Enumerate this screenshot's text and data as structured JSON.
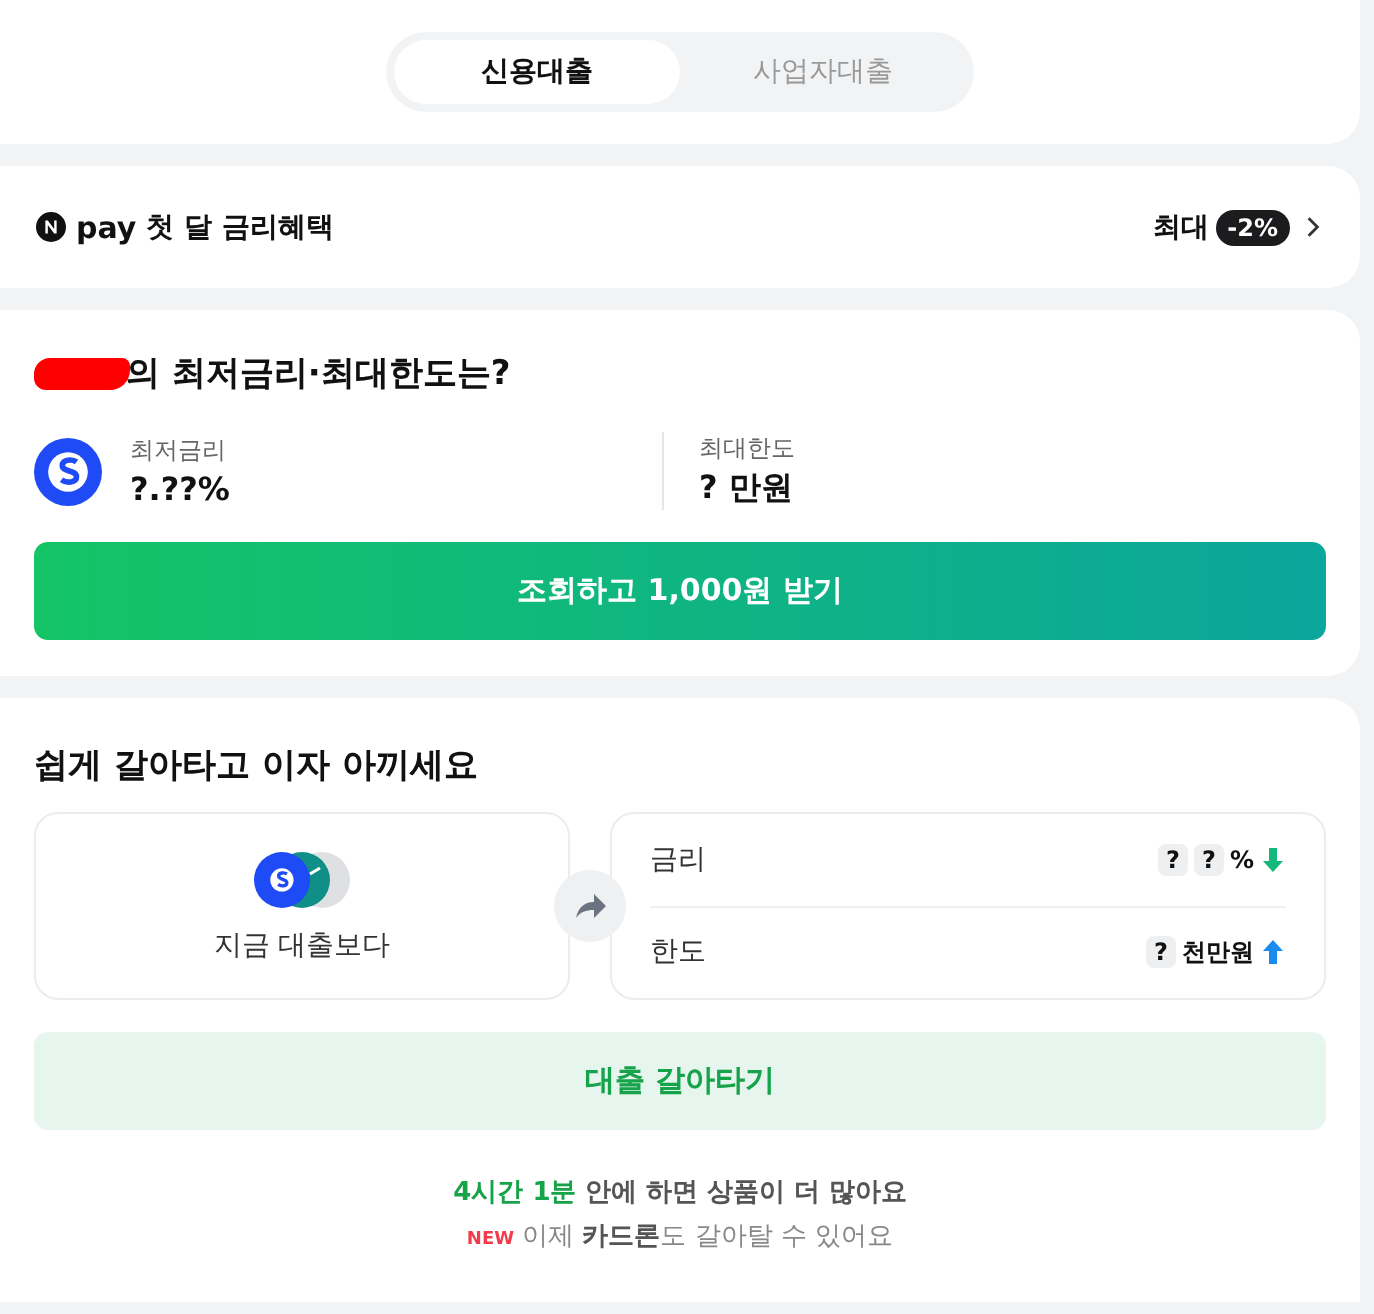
{
  "tabs": [
    {
      "label": "신용대출",
      "selected": true
    },
    {
      "label": "사업자대출",
      "selected": false
    }
  ],
  "promo": {
    "brand": "pay",
    "text": "첫 달 금리혜택",
    "prefix": "최대",
    "badge": "-2%"
  },
  "estimate": {
    "title": "의 최저금리·최대한도는?",
    "stats": [
      {
        "label": "최저금리",
        "value": "?.??%"
      },
      {
        "label": "최대한도",
        "value": "? 만원"
      }
    ],
    "button": "조회하고 1,000원 받기"
  },
  "refinance": {
    "title": "쉽게 갈아타고 이자 아끼세요",
    "current": "지금 대출보다",
    "rows": [
      {
        "label": "금리",
        "marks": [
          "?",
          "?"
        ],
        "unit": "%",
        "kind": "down"
      },
      {
        "label": "한도",
        "marks": [
          "?"
        ],
        "unit": "천만원",
        "kind": "up"
      }
    ],
    "button": "대출 갈아타기",
    "timer": "4시간 1분",
    "timer_text": "안에 하면 상품이 더 많아요",
    "new_badge": "NEW",
    "notice": "이제 **카드론**도 갈아탈 수 있어요"
  }
}
